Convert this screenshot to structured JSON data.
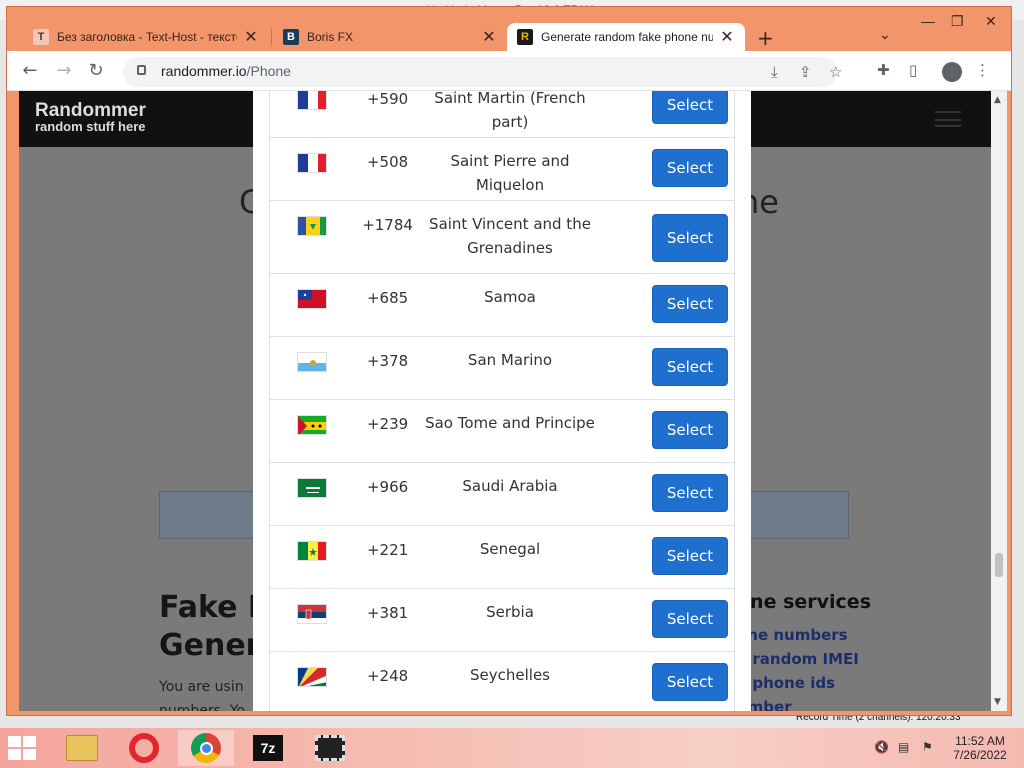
{
  "background_app": {
    "title": "Untitled - Vegas Pro 13.0 TRIAL",
    "record_time": "Record Time (2 channels): 120:20:33"
  },
  "browser": {
    "tabs": [
      {
        "label": "Без заголовка - Text-Host - текстовый хостинг",
        "favicon": "text-host-icon",
        "close": "✕"
      },
      {
        "label": "Boris FX",
        "favicon": "boris-fx-icon",
        "close": "✕"
      },
      {
        "label": "Generate random fake phone numbers",
        "favicon": "randommer-icon",
        "close": "✕"
      }
    ],
    "new_tab": "+",
    "url_host": "randommer.io",
    "url_path": "/Phone"
  },
  "site": {
    "brand_line1": "Randommer",
    "brand_line2": "random stuff here",
    "hero_left": "G",
    "hero_right": "ne",
    "fake_title_line1": "Fake N",
    "fake_title_line2": "Gener",
    "fake_text_line1": "You are usin",
    "fake_text_line2": "numbers. Yo",
    "services_title": "one services",
    "services": [
      "one numbers",
      "e random IMEI",
      "e phone ids",
      "umber"
    ]
  },
  "modal": {
    "rows": [
      {
        "flag": "flag-fr",
        "code": "+590",
        "country": "Saint Martin (French part)",
        "action": "Select"
      },
      {
        "flag": "flag-fr",
        "code": "+508",
        "country": "Saint Pierre and Miquelon",
        "action": "Select"
      },
      {
        "flag": "flag-vc",
        "code": "+1784",
        "country": "Saint Vincent and the Grenadines",
        "action": "Select"
      },
      {
        "flag": "flag-ws",
        "code": "+685",
        "country": "Samoa",
        "action": "Select"
      },
      {
        "flag": "flag-sm",
        "code": "+378",
        "country": "San Marino",
        "action": "Select"
      },
      {
        "flag": "flag-st",
        "code": "+239",
        "country": "Sao Tome and Principe",
        "action": "Select"
      },
      {
        "flag": "flag-sa",
        "code": "+966",
        "country": "Saudi Arabia",
        "action": "Select"
      },
      {
        "flag": "flag-sn",
        "code": "+221",
        "country": "Senegal",
        "action": "Select"
      },
      {
        "flag": "flag-rs",
        "code": "+381",
        "country": "Serbia",
        "action": "Select"
      },
      {
        "flag": "flag-sc",
        "code": "+248",
        "country": "Seychelles",
        "action": "Select"
      }
    ]
  },
  "taskbar": {
    "time": "11:52 AM",
    "date": "7/26/2022"
  },
  "colors": {
    "accent_button": "#1f6fce",
    "browser_frame": "#f2956b"
  }
}
